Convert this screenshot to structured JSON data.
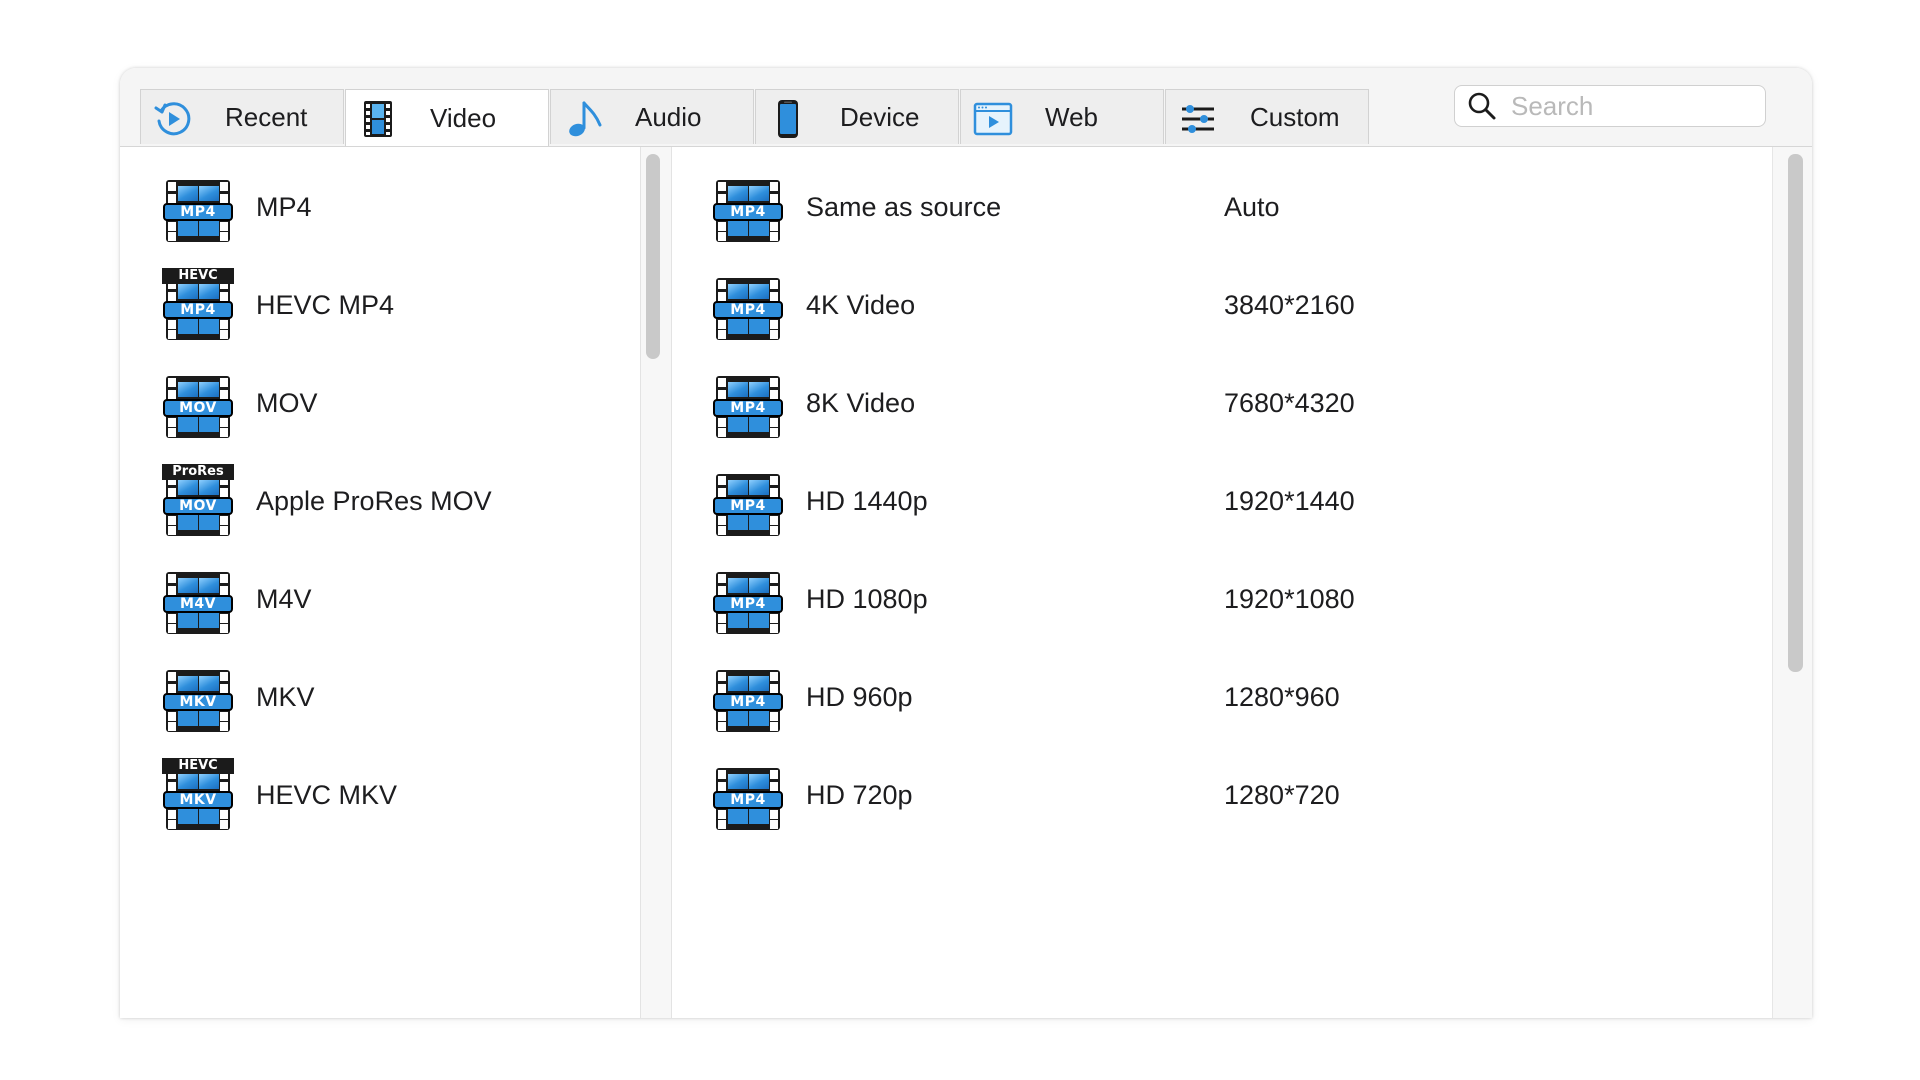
{
  "tabs": [
    {
      "label": "Recent",
      "icon": "recent-icon",
      "active": false
    },
    {
      "label": "Video",
      "icon": "film-icon",
      "active": true
    },
    {
      "label": "Audio",
      "icon": "music-note-icon",
      "active": false
    },
    {
      "label": "Device",
      "icon": "phone-icon",
      "active": false
    },
    {
      "label": "Web",
      "icon": "web-video-icon",
      "active": false
    },
    {
      "label": "Custom",
      "icon": "sliders-icon",
      "active": false
    }
  ],
  "search": {
    "placeholder": "Search",
    "value": ""
  },
  "formats": [
    {
      "name": "MP4",
      "badge": "MP4",
      "top_label": ""
    },
    {
      "name": "HEVC MP4",
      "badge": "MP4",
      "top_label": "HEVC"
    },
    {
      "name": "MOV",
      "badge": "MOV",
      "top_label": ""
    },
    {
      "name": "Apple ProRes MOV",
      "badge": "MOV",
      "top_label": "ProRes"
    },
    {
      "name": "M4V",
      "badge": "M4V",
      "top_label": ""
    },
    {
      "name": "MKV",
      "badge": "MKV",
      "top_label": ""
    },
    {
      "name": "HEVC MKV",
      "badge": "MKV",
      "top_label": "HEVC"
    }
  ],
  "presets": [
    {
      "name": "Same as source",
      "resolution": "Auto",
      "badge": "MP4"
    },
    {
      "name": "4K Video",
      "resolution": "3840*2160",
      "badge": "MP4"
    },
    {
      "name": "8K Video",
      "resolution": "7680*4320",
      "badge": "MP4"
    },
    {
      "name": "HD 1440p",
      "resolution": "1920*1440",
      "badge": "MP4"
    },
    {
      "name": "HD 1080p",
      "resolution": "1920*1080",
      "badge": "MP4"
    },
    {
      "name": "HD 960p",
      "resolution": "1280*960",
      "badge": "MP4"
    },
    {
      "name": "HD 720p",
      "resolution": "1280*720",
      "badge": "MP4"
    }
  ],
  "colors": {
    "accent": "#2f8fdc",
    "film": "#1b1b1b",
    "tab_bg": "#eeeeee",
    "tab_active_bg": "#ffffff"
  }
}
